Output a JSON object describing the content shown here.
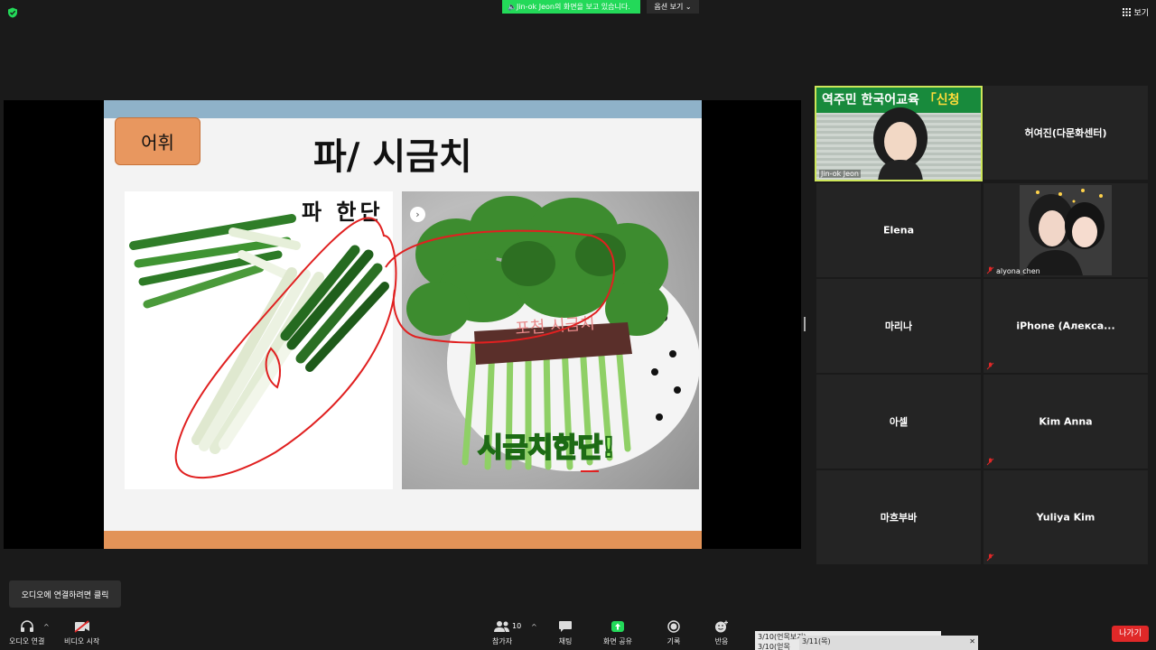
{
  "top": {
    "viewing_banner": "Jin-ok  Jeon의 화면을 보고 있습니다.",
    "view_options": "옵션 보기",
    "view_toggle": "보기"
  },
  "slide": {
    "badge": "어휘",
    "title": "파/ 시금치",
    "left_caption": "파 한단",
    "label_on_band": "포천 시금치",
    "bottom_text": "시금치한단!",
    "colors": {
      "topbar": "#8fb2c9",
      "bottombar": "#e29358",
      "badge": "#e8975f",
      "annotation": "#e02020"
    }
  },
  "gallery": {
    "speaker": {
      "name": "Jin-ok Jeon",
      "banner_prefix": "역주민 한국어교육 ",
      "banner_highlight": "「신청"
    },
    "tiles": [
      {
        "name": "허여진(다문화센터)",
        "muted": false
      },
      {
        "name": "Elena",
        "muted": false
      },
      {
        "name": "alyona chen",
        "muted": true,
        "has_video": true
      },
      {
        "name": "마리나",
        "muted": false
      },
      {
        "name": "iPhone  (Алекса...",
        "muted": true
      },
      {
        "name": "아셀",
        "muted": false
      },
      {
        "name": "Kim Anna",
        "muted": true
      },
      {
        "name": "마흐부바",
        "muted": false
      },
      {
        "name": "Yuliya Kim",
        "muted": true
      }
    ]
  },
  "toolbar": {
    "audio_tooltip": "오디오에 연결하려면 클릭",
    "audio": "오디오 연결",
    "video": "비디오 시작",
    "participants": "참가자",
    "participants_count": "10",
    "chat": "채팅",
    "share": "화면 공유",
    "record": "기록",
    "reactions": "반응",
    "leave": "나가기",
    "notes": [
      "3/10(언목보기)",
      "3/10(얻목",
      "3/11(목)"
    ],
    "share_color": "#23d959"
  }
}
